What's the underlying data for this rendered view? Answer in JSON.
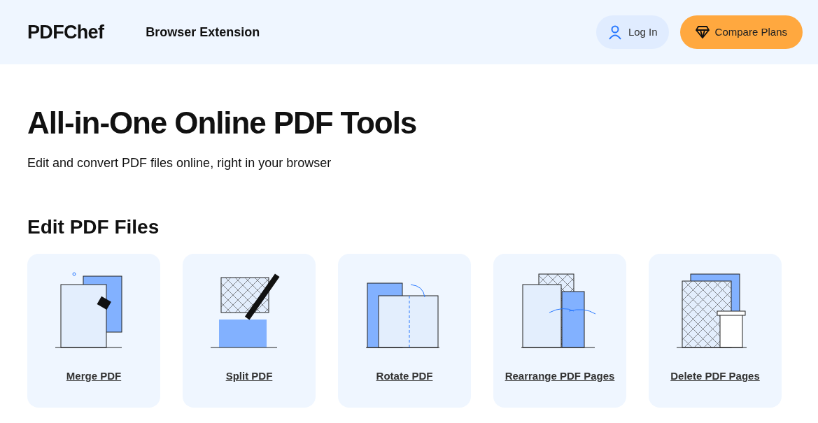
{
  "header": {
    "logo": "PDFChef",
    "nav_link": "Browser Extension",
    "login": "Log In",
    "compare": "Compare Plans"
  },
  "hero": {
    "title": "All-in-One Online PDF Tools",
    "subtitle": "Edit and convert PDF files online, right in your browser"
  },
  "section": {
    "title": "Edit PDF Files",
    "tools": [
      {
        "kind": "merge",
        "label": "Merge PDF"
      },
      {
        "kind": "split",
        "label": "Split PDF"
      },
      {
        "kind": "rotate",
        "label": "Rotate PDF"
      },
      {
        "kind": "rearrange",
        "label": "Rearrange PDF Pages"
      },
      {
        "kind": "delete",
        "label": "Delete PDF Pages"
      }
    ]
  }
}
